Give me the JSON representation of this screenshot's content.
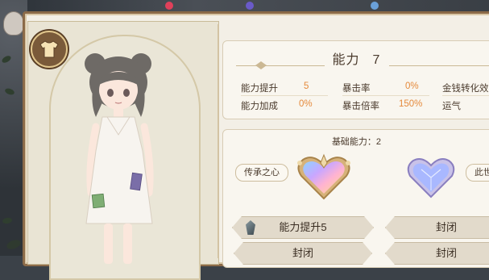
{
  "ability": {
    "title": "能力",
    "level": "7",
    "stats": [
      {
        "label": "能力提升",
        "value": "5"
      },
      {
        "label": "暴击率",
        "value": "0%"
      },
      {
        "label": "金钱转化效率",
        "value": ""
      },
      {
        "label": "能力加成",
        "value": "0%"
      },
      {
        "label": "暴击倍率",
        "value": "150%"
      },
      {
        "label": "运气",
        "value": ""
      }
    ]
  },
  "basic": {
    "title": "基础能力：2",
    "slots": [
      {
        "tag": "传承之心",
        "heart_icon": "rainbow-heart-icon"
      },
      {
        "tag": "此世",
        "heart_icon": "crystal-heart-icon"
      }
    ]
  },
  "buttons": [
    {
      "label": "能力提升5",
      "icon": "crystal-icon"
    },
    {
      "label": "封闭"
    },
    {
      "label": "封闭"
    },
    {
      "label": "封闭"
    }
  ],
  "icons": {
    "outfit": "shirt-icon"
  },
  "colors": {
    "accent_orange": "#e58a3c",
    "frame_brown": "#8b6a48",
    "panel_bg": "#f3efe6"
  }
}
